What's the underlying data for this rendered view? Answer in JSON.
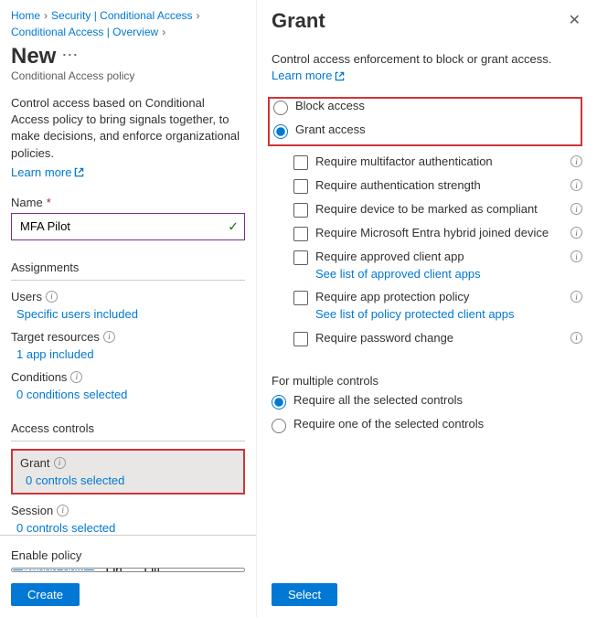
{
  "breadcrumb": {
    "items": [
      {
        "label": "Home"
      },
      {
        "label": "Security | Conditional Access"
      },
      {
        "label": "Conditional Access | Overview"
      }
    ]
  },
  "page": {
    "title": "New",
    "subtitle": "Conditional Access policy",
    "description": "Control access based on Conditional Access policy to bring signals together, to make decisions, and enforce organizational policies.",
    "learn_more": "Learn more"
  },
  "name_field": {
    "label": "Name",
    "value": "MFA Pilot"
  },
  "assignments": {
    "header": "Assignments",
    "users": {
      "label": "Users",
      "link": "Specific users included"
    },
    "targets": {
      "label": "Target resources",
      "link": "1 app included"
    },
    "conditions": {
      "label": "Conditions",
      "link": "0 conditions selected"
    }
  },
  "access_controls": {
    "header": "Access controls",
    "grant": {
      "label": "Grant",
      "link": "0 controls selected"
    },
    "session": {
      "label": "Session",
      "link": "0 controls selected"
    }
  },
  "enable_policy": {
    "label": "Enable policy",
    "options": [
      "Report-only",
      "On",
      "Off"
    ],
    "selected": "Report-only"
  },
  "buttons": {
    "create": "Create",
    "select": "Select"
  },
  "grant_panel": {
    "title": "Grant",
    "description": "Control access enforcement to block or grant access.",
    "learn_more": "Learn more",
    "radio": {
      "block": "Block access",
      "grant": "Grant access",
      "selected": "grant"
    },
    "checks": {
      "mfa": "Require multifactor authentication",
      "auth_strength": "Require authentication strength",
      "compliant": "Require device to be marked as compliant",
      "hybrid": "Require Microsoft Entra hybrid joined device",
      "approved_app": "Require approved client app",
      "approved_app_link": "See list of approved client apps",
      "protection": "Require app protection policy",
      "protection_link": "See list of policy protected client apps",
      "password": "Require password change"
    },
    "multi": {
      "header": "For multiple controls",
      "all": "Require all the selected controls",
      "one": "Require one of the selected controls",
      "selected": "all"
    }
  }
}
